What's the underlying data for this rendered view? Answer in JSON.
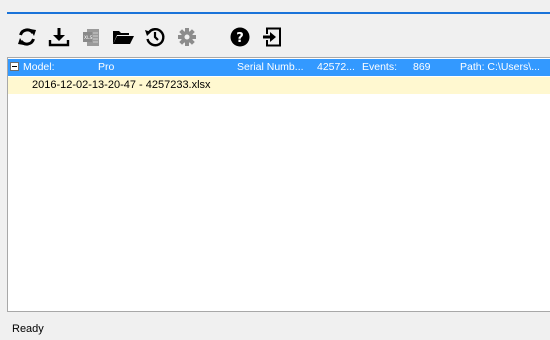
{
  "toolbar": {
    "buttons": [
      {
        "name": "refresh",
        "icon": "refresh-icon"
      },
      {
        "name": "download",
        "icon": "download-icon"
      },
      {
        "name": "export-xls",
        "icon": "xls-file-icon",
        "disabled": true
      },
      {
        "name": "open-folder",
        "icon": "open-folder-icon"
      },
      {
        "name": "history",
        "icon": "clock-icon"
      },
      {
        "name": "settings",
        "icon": "gear-icon",
        "disabled": true
      },
      {
        "name": "help",
        "icon": "help-icon"
      },
      {
        "name": "exit",
        "icon": "exit-icon"
      }
    ]
  },
  "tree": {
    "model_row": {
      "model_label": "Model:",
      "model_value": "Pro",
      "serial_label": "Serial Numb...",
      "serial_value": "42572...",
      "events_label": "Events:",
      "events_value": "869",
      "path_label": "Path: C:\\Users\\..."
    },
    "children": [
      {
        "label": "2016-12-02-13-20-47 - 4257233.xlsx"
      }
    ]
  },
  "status": {
    "text": "Ready"
  },
  "colors": {
    "selection": "#3399ff",
    "accent": "#1a73d9",
    "file_row": "#fff8d0"
  }
}
